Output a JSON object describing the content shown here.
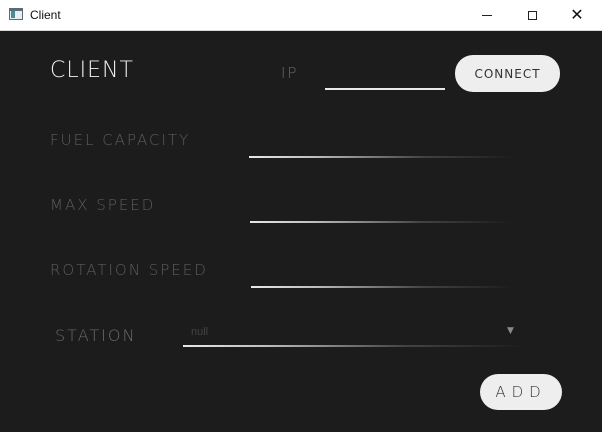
{
  "window": {
    "title": "Client",
    "minimize_glyph": "",
    "close_glyph": "✕"
  },
  "header": {
    "app_title": "CLIENT",
    "ip_label": "IP",
    "ip_value": "",
    "connect_label": "CONNECT"
  },
  "fields": {
    "fuel_capacity": {
      "label": "FUEL CAPACITY",
      "value": ""
    },
    "max_speed": {
      "label": "MAX SPEED",
      "value": ""
    },
    "rotation_speed": {
      "label": "ROTATION SPEED",
      "value": ""
    }
  },
  "station": {
    "label": "STATION",
    "selected": "null",
    "arrow": "▼"
  },
  "add_button": {
    "label": "ADD"
  },
  "colors": {
    "background": "#1c1c1c",
    "button": "#eeeeee",
    "line": "#e8e8e8"
  }
}
